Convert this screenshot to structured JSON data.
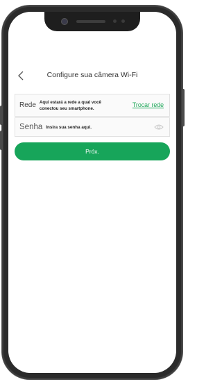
{
  "header": {
    "title": "Configure sua câmera Wi-Fi",
    "back_icon": "chevron-left-icon"
  },
  "network": {
    "label": "Rede",
    "info": "Aqui estará a rede a qual você conectou seu smartphone.",
    "change_label": "Trocar rede"
  },
  "password": {
    "label": "Senha",
    "placeholder": "Insira sua senha aqui.",
    "toggle_icon": "eye-icon"
  },
  "next_button": {
    "label": "Próx."
  },
  "colors": {
    "accent": "#17a55a",
    "link": "#1fa85a",
    "phone_frame": "#2b2b2b"
  }
}
